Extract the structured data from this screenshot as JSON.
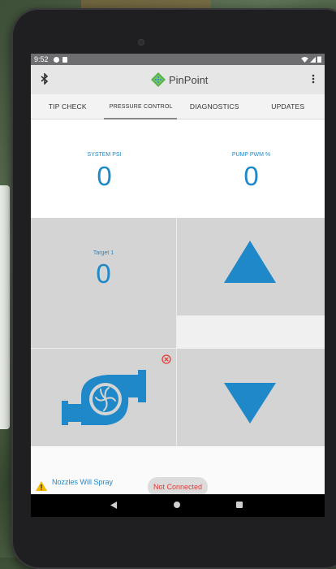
{
  "status_bar": {
    "time": "9:52"
  },
  "app_bar": {
    "title": "PinPoint"
  },
  "tabs": [
    {
      "label": "TIP CHECK"
    },
    {
      "label": "PRESSURE CONTROL"
    },
    {
      "label": "DIAGNOSTICS"
    },
    {
      "label": "UPDATES"
    }
  ],
  "readouts": {
    "system_psi": {
      "label": "SYSTEM PSI",
      "value": "0"
    },
    "pump_pwm": {
      "label": "PUMP PWM %",
      "value": "0"
    }
  },
  "target": {
    "label": "Target 1",
    "value": "0"
  },
  "warning": {
    "text": "Nozzles Will Spray"
  },
  "connection": {
    "status": "Not Connected"
  },
  "colors": {
    "accent": "#1e88c8",
    "error": "#e53935",
    "warning": "#f5b800"
  },
  "icons": [
    "bluetooth-icon",
    "overflow-menu-icon",
    "increase-arrow-icon",
    "decrease-arrow-icon",
    "pump-icon",
    "error-x-icon",
    "warning-icon"
  ]
}
